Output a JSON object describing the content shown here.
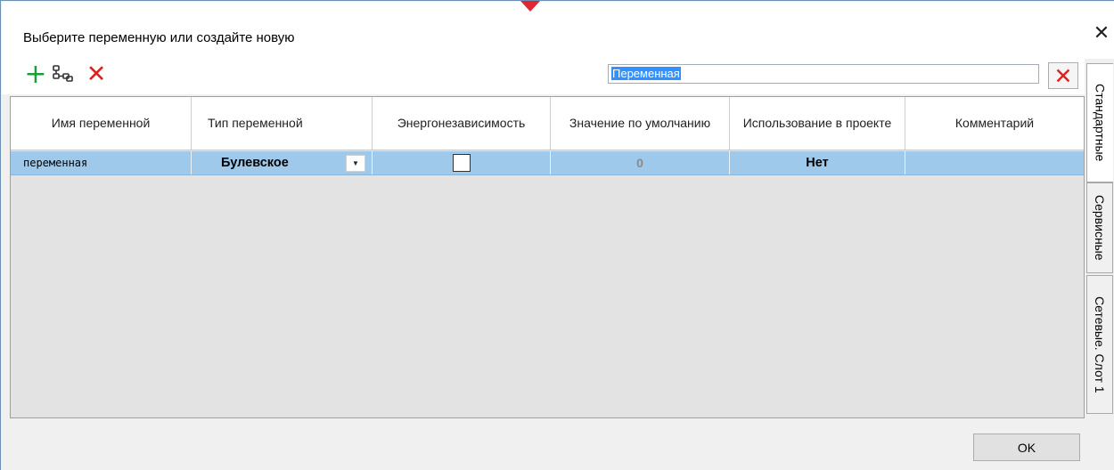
{
  "dialog": {
    "title": "Выберите переменную или создайте новую",
    "close_icon": "close-icon"
  },
  "toolbar": {
    "add_icon": "plus-icon",
    "link_icon": "link-variables-icon",
    "delete_icon": "delete-icon",
    "search_value": "Переменная",
    "search_clear_icon": "clear-search-icon"
  },
  "grid": {
    "columns": [
      "Имя переменной",
      "Тип переменной",
      "Энергонезависимость",
      "Значение по умолчанию",
      "Использование в проекте",
      "Комментарий"
    ],
    "rows": [
      {
        "name": "переменная",
        "type": "Булевское",
        "nonvolatile": false,
        "default_value": "0",
        "usage": "Нет",
        "comment": ""
      }
    ]
  },
  "side_tabs": [
    "Стандартные",
    "Сервисные",
    "Сетевые. Слот 1"
  ],
  "buttons": {
    "ok": "OK"
  },
  "colors": {
    "selected_row": "#9fc9ea",
    "add_icon": "#1f9a3c",
    "delete_icon": "#e02020",
    "arrow_marker": "#e0262f"
  }
}
